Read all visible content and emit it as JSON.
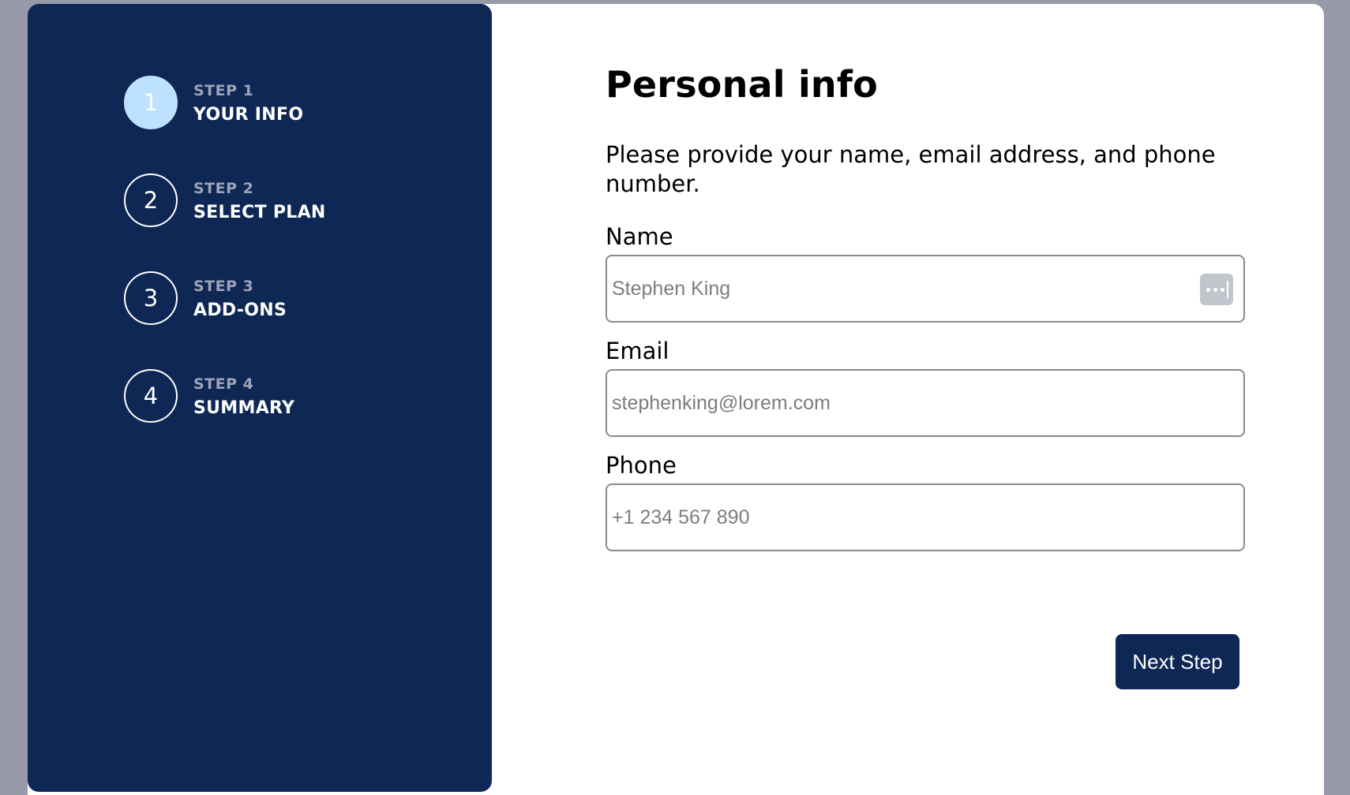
{
  "sidebar": {
    "steps": [
      {
        "number": "1",
        "step_label": "STEP 1",
        "title": "YOUR INFO",
        "active": true
      },
      {
        "number": "2",
        "step_label": "STEP 2",
        "title": "SELECT PLAN",
        "active": false
      },
      {
        "number": "3",
        "step_label": "STEP 3",
        "title": "ADD-ONS",
        "active": false
      },
      {
        "number": "4",
        "step_label": "STEP 4",
        "title": "SUMMARY",
        "active": false
      }
    ]
  },
  "form": {
    "title": "Personal info",
    "subtitle": "Please provide your name, email address, and phone number.",
    "name": {
      "label": "Name",
      "placeholder": "Stephen King",
      "value": ""
    },
    "email": {
      "label": "Email",
      "placeholder": "stephenking@lorem.com",
      "value": ""
    },
    "phone": {
      "label": "Phone",
      "placeholder": "+1 234 567 890",
      "value": ""
    },
    "next_button_label": "Next Step"
  },
  "colors": {
    "sidebar_bg": "#0e2755",
    "active_step": "#bee2fd",
    "page_bg": "#979aa8",
    "button_bg": "#0e2755"
  },
  "icons": {
    "autofill": "keychain-autofill-icon"
  }
}
